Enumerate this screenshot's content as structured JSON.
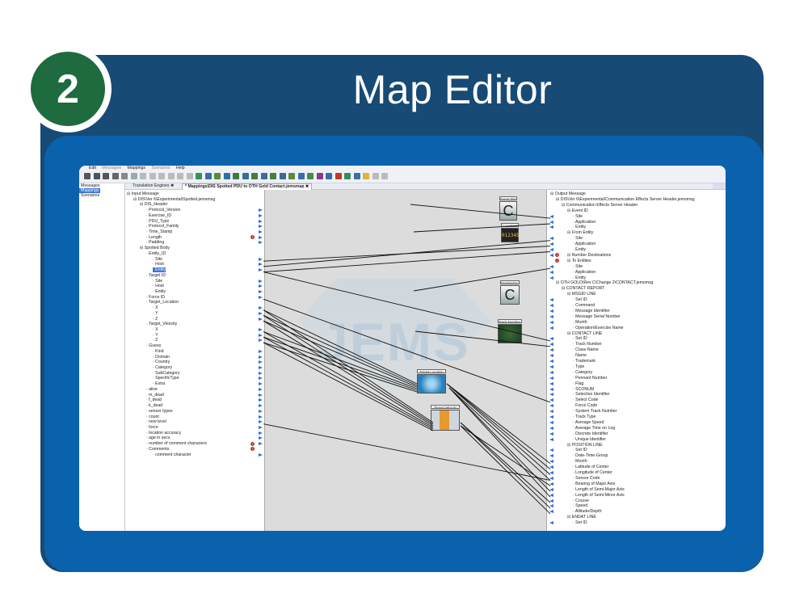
{
  "step_number": "2",
  "title": "Map Editor",
  "menu": [
    "Edit",
    "Messages",
    "Mappings",
    "Scenarios",
    "Help"
  ],
  "left_nav": [
    "Messages",
    "Mappings",
    "Scenarios"
  ],
  "tabs": [
    "Translation Engines",
    "* Mappings\\DIS Spotted PDU to OTH Gold Contact.jemsmap"
  ],
  "input_tree": [
    "Input Message",
    "DIS\\Ver 6\\Experimental\\Spotted.jemsmsg",
    "DIS_Header",
    "Protocol_Version",
    "Exercise_ID",
    "PDU_Type",
    "Protocol_Family",
    "Time_Stamp",
    "Length",
    "Padding",
    "Spotted Body",
    "Entity_ID",
    "Site",
    "Host",
    "Entity",
    "Target ID",
    "Site",
    "Host",
    "Entity",
    "Force ID",
    "Target_Location",
    "X",
    "Y",
    "Z",
    "Target_Velocity",
    "X",
    "Y",
    "Z",
    "Guess",
    "Kind",
    "Domain",
    "Country",
    "Category",
    "SubCategory",
    "SpecificType",
    "Extra",
    "alive",
    "m_dead",
    "f_dead",
    "k_dead",
    "sensor types",
    "count",
    "new level",
    "force",
    "location accuracy",
    "age in secs",
    "number of comment characters",
    "Comments",
    "comment character"
  ],
  "output_tree": [
    "Output Message",
    "DIS\\Ver 6\\Experimental\\Communication Effects Server Header.jemsmsg",
    "Communication Effects Server Header",
    "Event ID",
    "Site",
    "Application",
    "Entity",
    "From Entity",
    "Site",
    "Application",
    "Entity",
    "Number Destinations",
    "To Entities",
    "Site",
    "Application",
    "Entity",
    "OTH GOLD\\Rev C\\Change 2\\CONTACT.jemsmsg",
    "CONTACT REPORT",
    "MSGID LINE",
    "Set ID",
    "Command",
    "Message Identifier",
    "Message Serial Number",
    "Month",
    "Operation/Exercise Name",
    "CONTACT LINE",
    "Set ID",
    "Track Number",
    "Class-Name",
    "Name",
    "Trademark",
    "Type",
    "Category",
    "Pennant Number",
    "Flag",
    "SCONUM",
    "Selective Identifier",
    "Select Code",
    "Force Code",
    "System Track Number",
    "Track Type",
    "Average Speed",
    "Average Time on Leg",
    "Discrete Identifier",
    "Unique Identifier",
    "POSITION LINE",
    "Set ID",
    "Date-Time-Group",
    "Month",
    "Latitude of Center",
    "Longitude of Center",
    "Sensor Code",
    "Bearing of Major Axis",
    "Length of Semi-Major Axis",
    "Length of Semi-Minor Axis",
    "Course",
    "Speed",
    "Altitude/Depth",
    "ENDAT LINE",
    "Set ID"
  ],
  "nodes": [
    {
      "label": "Event Site",
      "glyph": "C"
    },
    {
      "label": "Counter 1",
      "glyph": "012345"
    },
    {
      "label": "Destination Entit",
      "glyph": "C"
    },
    {
      "label": "Track Number G",
      "glyph": ""
    },
    {
      "label": "Target Location",
      "glyph": ""
    },
    {
      "label": "Target Velocity",
      "glyph": ""
    }
  ],
  "watermark": "JEMS",
  "colors": {
    "dark_blue": "#174a75",
    "blue": "#0a62ad",
    "green": "#1d6b3f",
    "arrow": "#2b6fd6",
    "select": "#3875d7"
  }
}
